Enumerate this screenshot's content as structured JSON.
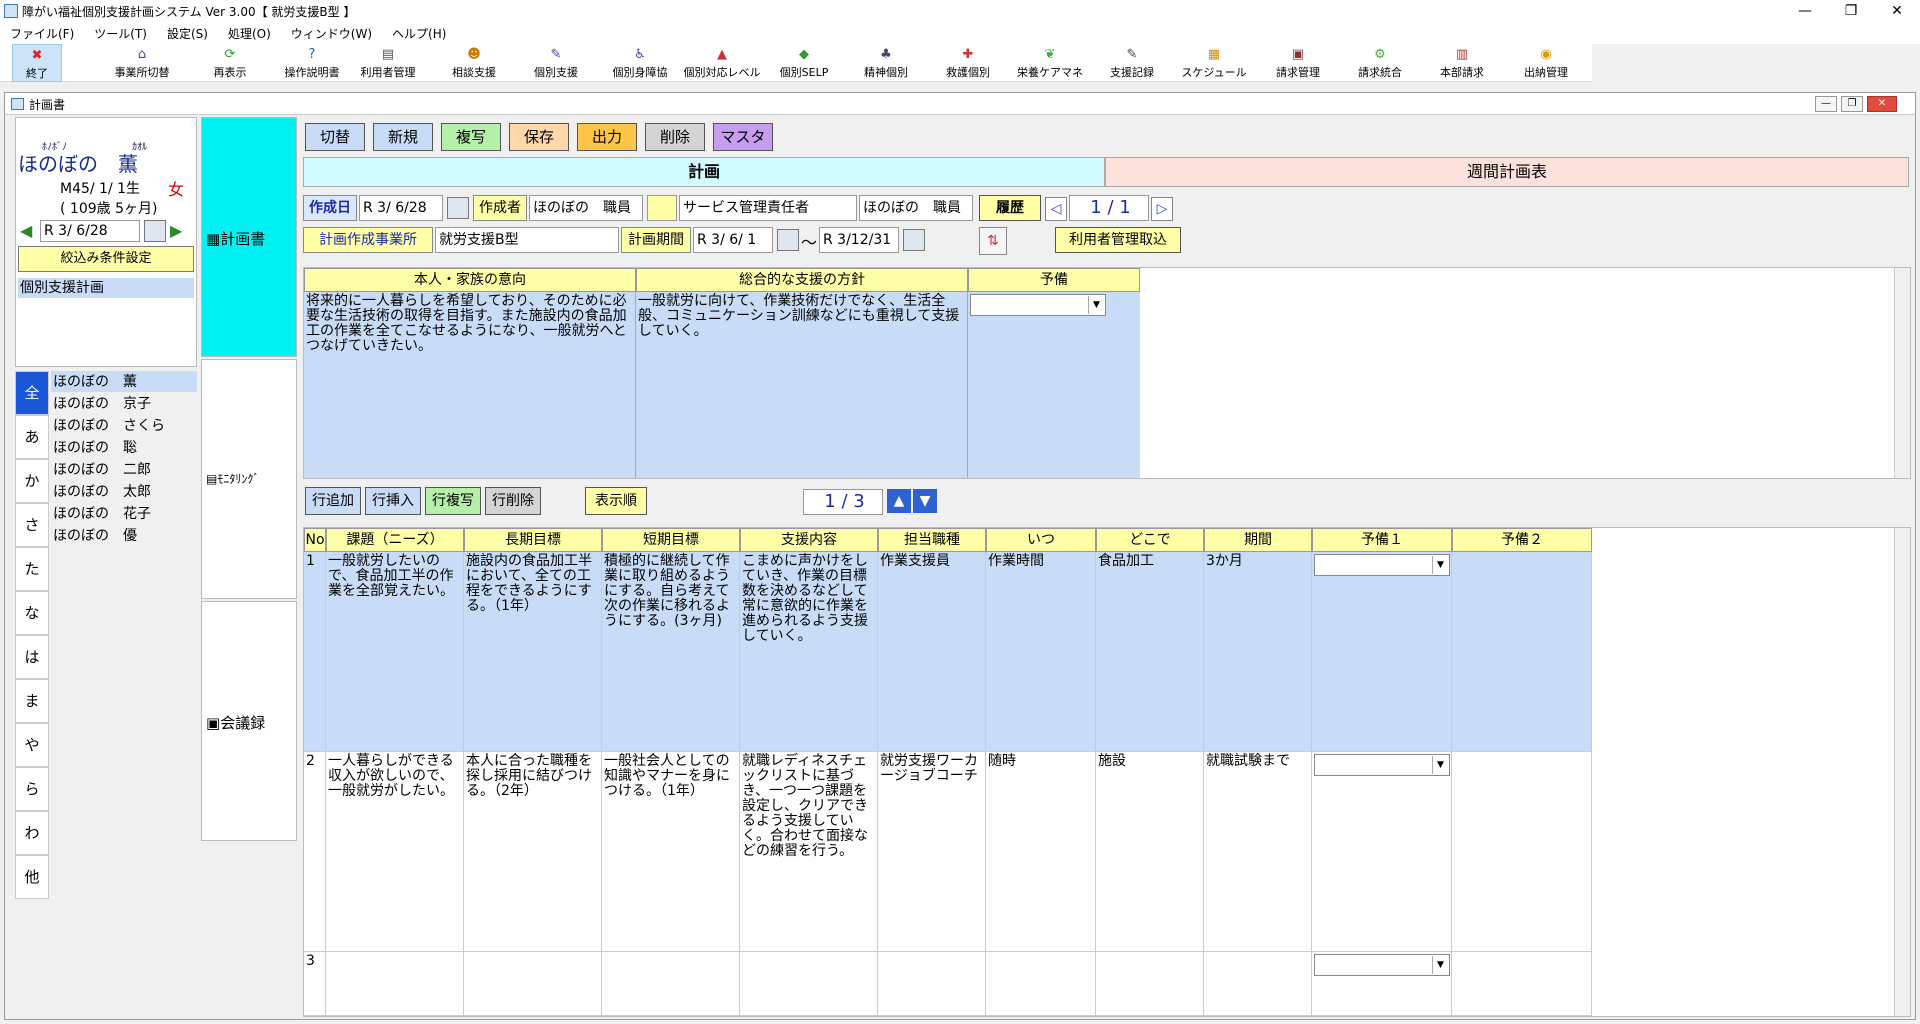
{
  "window": {
    "title": "障がい福祉個別支援計画システム Ver 3.00【 就労支援B型 】",
    "ctrl_min": "—",
    "ctrl_max": "❐",
    "ctrl_close": "✕"
  },
  "menu": [
    "ファイル(F)",
    "ツール(T)",
    "設定(S)",
    "処理(O)",
    "ウィンドウ(W)",
    "ヘルプ(H)"
  ],
  "toolbar": [
    {
      "label": "終了",
      "icon": "close-x-icon",
      "glyph": "✖",
      "color": "#d22"
    },
    {
      "label": "事業所切替",
      "icon": "building-icon",
      "glyph": "⌂",
      "color": "#448"
    },
    {
      "label": "再表示",
      "icon": "refresh-icon",
      "glyph": "⟳",
      "color": "#2a2"
    },
    {
      "label": "操作説明書",
      "icon": "help-icon",
      "glyph": "?",
      "color": "#2a5ca8"
    },
    {
      "label": "利用者管理",
      "icon": "users-icon",
      "glyph": "▤",
      "color": "#555"
    },
    {
      "label": "相談支援",
      "icon": "consult-icon",
      "glyph": "☻",
      "color": "#c70"
    },
    {
      "label": "個別支援",
      "icon": "person-icon",
      "glyph": "✎",
      "color": "#44a"
    },
    {
      "label": "個別身障協",
      "icon": "disability-icon",
      "glyph": "♿",
      "color": "#44a"
    },
    {
      "label": "個別対応レベル",
      "icon": "level-icon",
      "glyph": "▲",
      "color": "#c33"
    },
    {
      "label": "個別SELP",
      "icon": "selp-icon",
      "glyph": "◆",
      "color": "#393"
    },
    {
      "label": "精神個別",
      "icon": "mental-icon",
      "glyph": "♣",
      "color": "#446"
    },
    {
      "label": "救護個別",
      "icon": "rescue-icon",
      "glyph": "✚",
      "color": "#c33"
    },
    {
      "label": "栄養ケアマネ",
      "icon": "nutrition-icon",
      "glyph": "❦",
      "color": "#4a4"
    },
    {
      "label": "支援記録",
      "icon": "record-icon",
      "glyph": "✎",
      "color": "#444"
    },
    {
      "label": "スケジュール",
      "icon": "calendar-icon",
      "glyph": "▦",
      "color": "#d80"
    },
    {
      "label": "請求管理",
      "icon": "billing-icon",
      "glyph": "▣",
      "color": "#833"
    },
    {
      "label": "請求統合",
      "icon": "merge-icon",
      "glyph": "⚙",
      "color": "#4a4"
    },
    {
      "label": "本部請求",
      "icon": "hq-icon",
      "glyph": "▥",
      "color": "#a33"
    },
    {
      "label": "出納管理",
      "icon": "cash-icon",
      "glyph": "◉",
      "color": "#d90"
    }
  ],
  "mdi_title": "計画書",
  "client": {
    "furigana1": "ﾎﾉﾎﾞﾉ",
    "furigana2": "ｶｵﾙ",
    "name": "ほのぼの　薫",
    "birth": "M45/ 1/ 1生",
    "sex": "女",
    "age": "( 109歳 5ヶ月)",
    "date": "R 3/ 6/28",
    "filter_button": "絞込み条件設定",
    "doc_item": "個別支援計画"
  },
  "kana_tabs": [
    "全",
    "あ",
    "か",
    "さ",
    "た",
    "な",
    "は",
    "ま",
    "や",
    "ら",
    "わ",
    "他"
  ],
  "clients": [
    "ほのぼの　薫",
    "ほのぼの　京子",
    "ほのぼの　さくら",
    "ほのぼの　聡",
    "ほのぼの　二郎",
    "ほのぼの　太郎",
    "ほのぼの　花子",
    "ほのぼの　優"
  ],
  "nav": {
    "plan": "計画書",
    "monitoring": "ﾓﾆﾀﾘﾝｸﾞ",
    "meeting": "会議録"
  },
  "actions": {
    "switch": "切替",
    "new": "新規",
    "copy": "複写",
    "save": "保存",
    "output": "出力",
    "delete": "削除",
    "master": "マスタ"
  },
  "tabs": {
    "plan": "計画",
    "weekly": "週間計画表"
  },
  "form": {
    "created_label": "作成日",
    "created_date": "R 3/ 6/28",
    "author_label": "作成者",
    "author": "ほのぼの　職員",
    "role": "サービス管理責任者",
    "manager": "ほのぼの　職員",
    "history_button": "履歴",
    "page": "1 / 1",
    "office_label": "計画作成事業所",
    "office": "就労支援B型",
    "period_label": "計画期間",
    "period_from": "R 3/ 6/ 1",
    "tilde": "〜",
    "period_to": "R 3/12/31",
    "import_button": "利用者管理取込"
  },
  "summary": {
    "h1": "本人・家族の意向",
    "h2": "総合的な支援の方針",
    "h3": "予備",
    "t1": "将来的に一人暮らしを希望しており、そのために必要な生活技術の取得を目指す。また施設内の食品加工の作業を全てこなせるようになり、一般就労へとつなげていきたい。",
    "t2": "一般就労に向けて、作業技術だけでなく、生活全般、コミュニケーション訓練などにも重視して支援していく。"
  },
  "grid_buttons": {
    "add": "行追加",
    "insert": "行挿入",
    "copy": "行複写",
    "delete": "行削除",
    "order": "表示順",
    "page": "1 / 3"
  },
  "grid_headers": [
    "No",
    "課題（ニーズ）",
    "長期目標",
    "短期目標",
    "支援内容",
    "担当職種",
    "いつ",
    "どこで",
    "期間",
    "予備１",
    "予備２"
  ],
  "rows": [
    [
      "1",
      "一般就労したいので、食品加工半の作業を全部覚えたい。",
      "施設内の食品加工半において、全ての工程をできるようにする。（1年）",
      "積極的に継続して作業に取り組めるようにする。自ら考えて次の作業に移れるようにする。(3ヶ月)",
      "こまめに声かけをしていき、作業の目標数を決めるなどして常に意欲的に作業を進められるよう支援していく。",
      "作業支援員",
      "作業時間",
      "食品加工",
      "3か月"
    ],
    [
      "2",
      "一人暮らしができる収入が欲しいので、一般就労がしたい。",
      "本人に合った職種を探し採用に結びつける。（2年）",
      "一般社会人としての知識やマナーを身につける。（1年）",
      "就職レディネスチェックリストに基づき、一つ一つ課題を設定し、クリアできるよう支援していく。合わせて面接などの練習を行う。",
      "就労支援ワーカージョブコーチ",
      "随時",
      "施設",
      "就職試験まで"
    ],
    [
      "3",
      "",
      "",
      "",
      "",
      "",
      "",
      "",
      ""
    ]
  ]
}
